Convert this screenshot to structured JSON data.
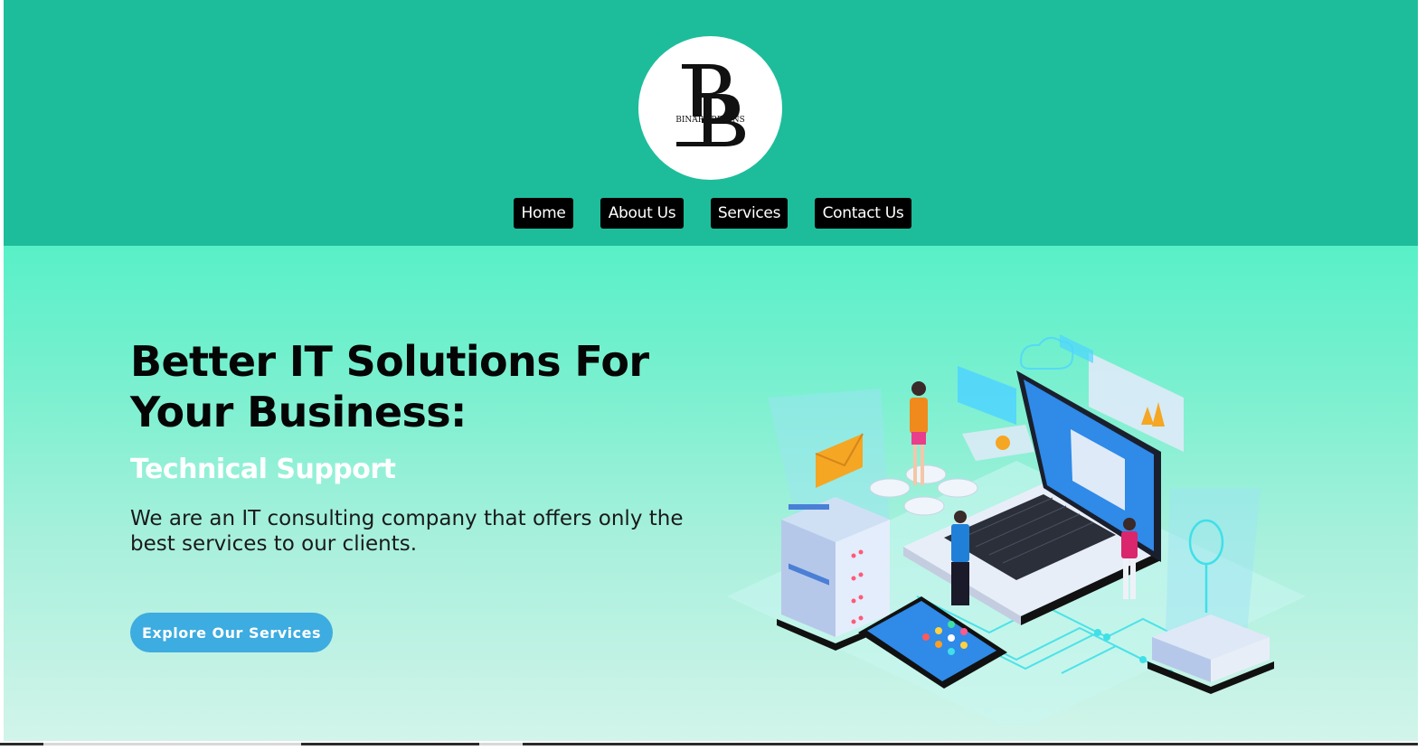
{
  "brand": {
    "monogram": "BB",
    "name": "BINARY-BRAINS"
  },
  "nav": {
    "home": "Home",
    "about": "About Us",
    "services": "Services",
    "contact": "Contact Us"
  },
  "hero": {
    "headline_line1": "Better IT Solutions For",
    "headline_line2": "Your Business:",
    "subheading": "Technical Support",
    "description": "We are an IT consulting company that offers only the best services to our clients.",
    "cta_label": "Explore Our Services"
  },
  "colors": {
    "header_bg": "#1dbd9b",
    "hero_gradient_top": "#58f0c8",
    "hero_gradient_bottom": "#d2f4ea",
    "nav_button_bg": "#000000",
    "cta_bg": "#3dace0"
  },
  "icons": {
    "illustration": "it-solutions-isometric-illustration",
    "logo": "binary-brains-logo"
  }
}
